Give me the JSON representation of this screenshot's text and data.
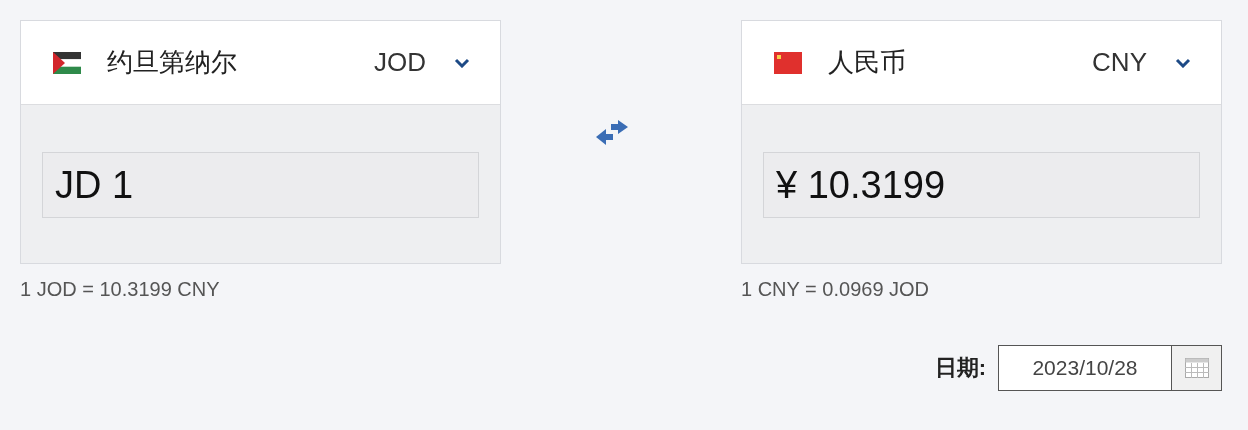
{
  "converters": [
    {
      "kind": "jordan",
      "currency_name": "约旦第纳尔",
      "code": "JOD",
      "amount": "JD 1",
      "rate": "1 JOD = 10.3199 CNY"
    },
    {
      "kind": "china",
      "currency_name": "人民币",
      "code": "CNY",
      "amount": "¥ 10.3199",
      "rate": "1 CNY = 0.0969 JOD"
    }
  ],
  "date": {
    "label": "日期:",
    "value": "2023/10/28"
  }
}
